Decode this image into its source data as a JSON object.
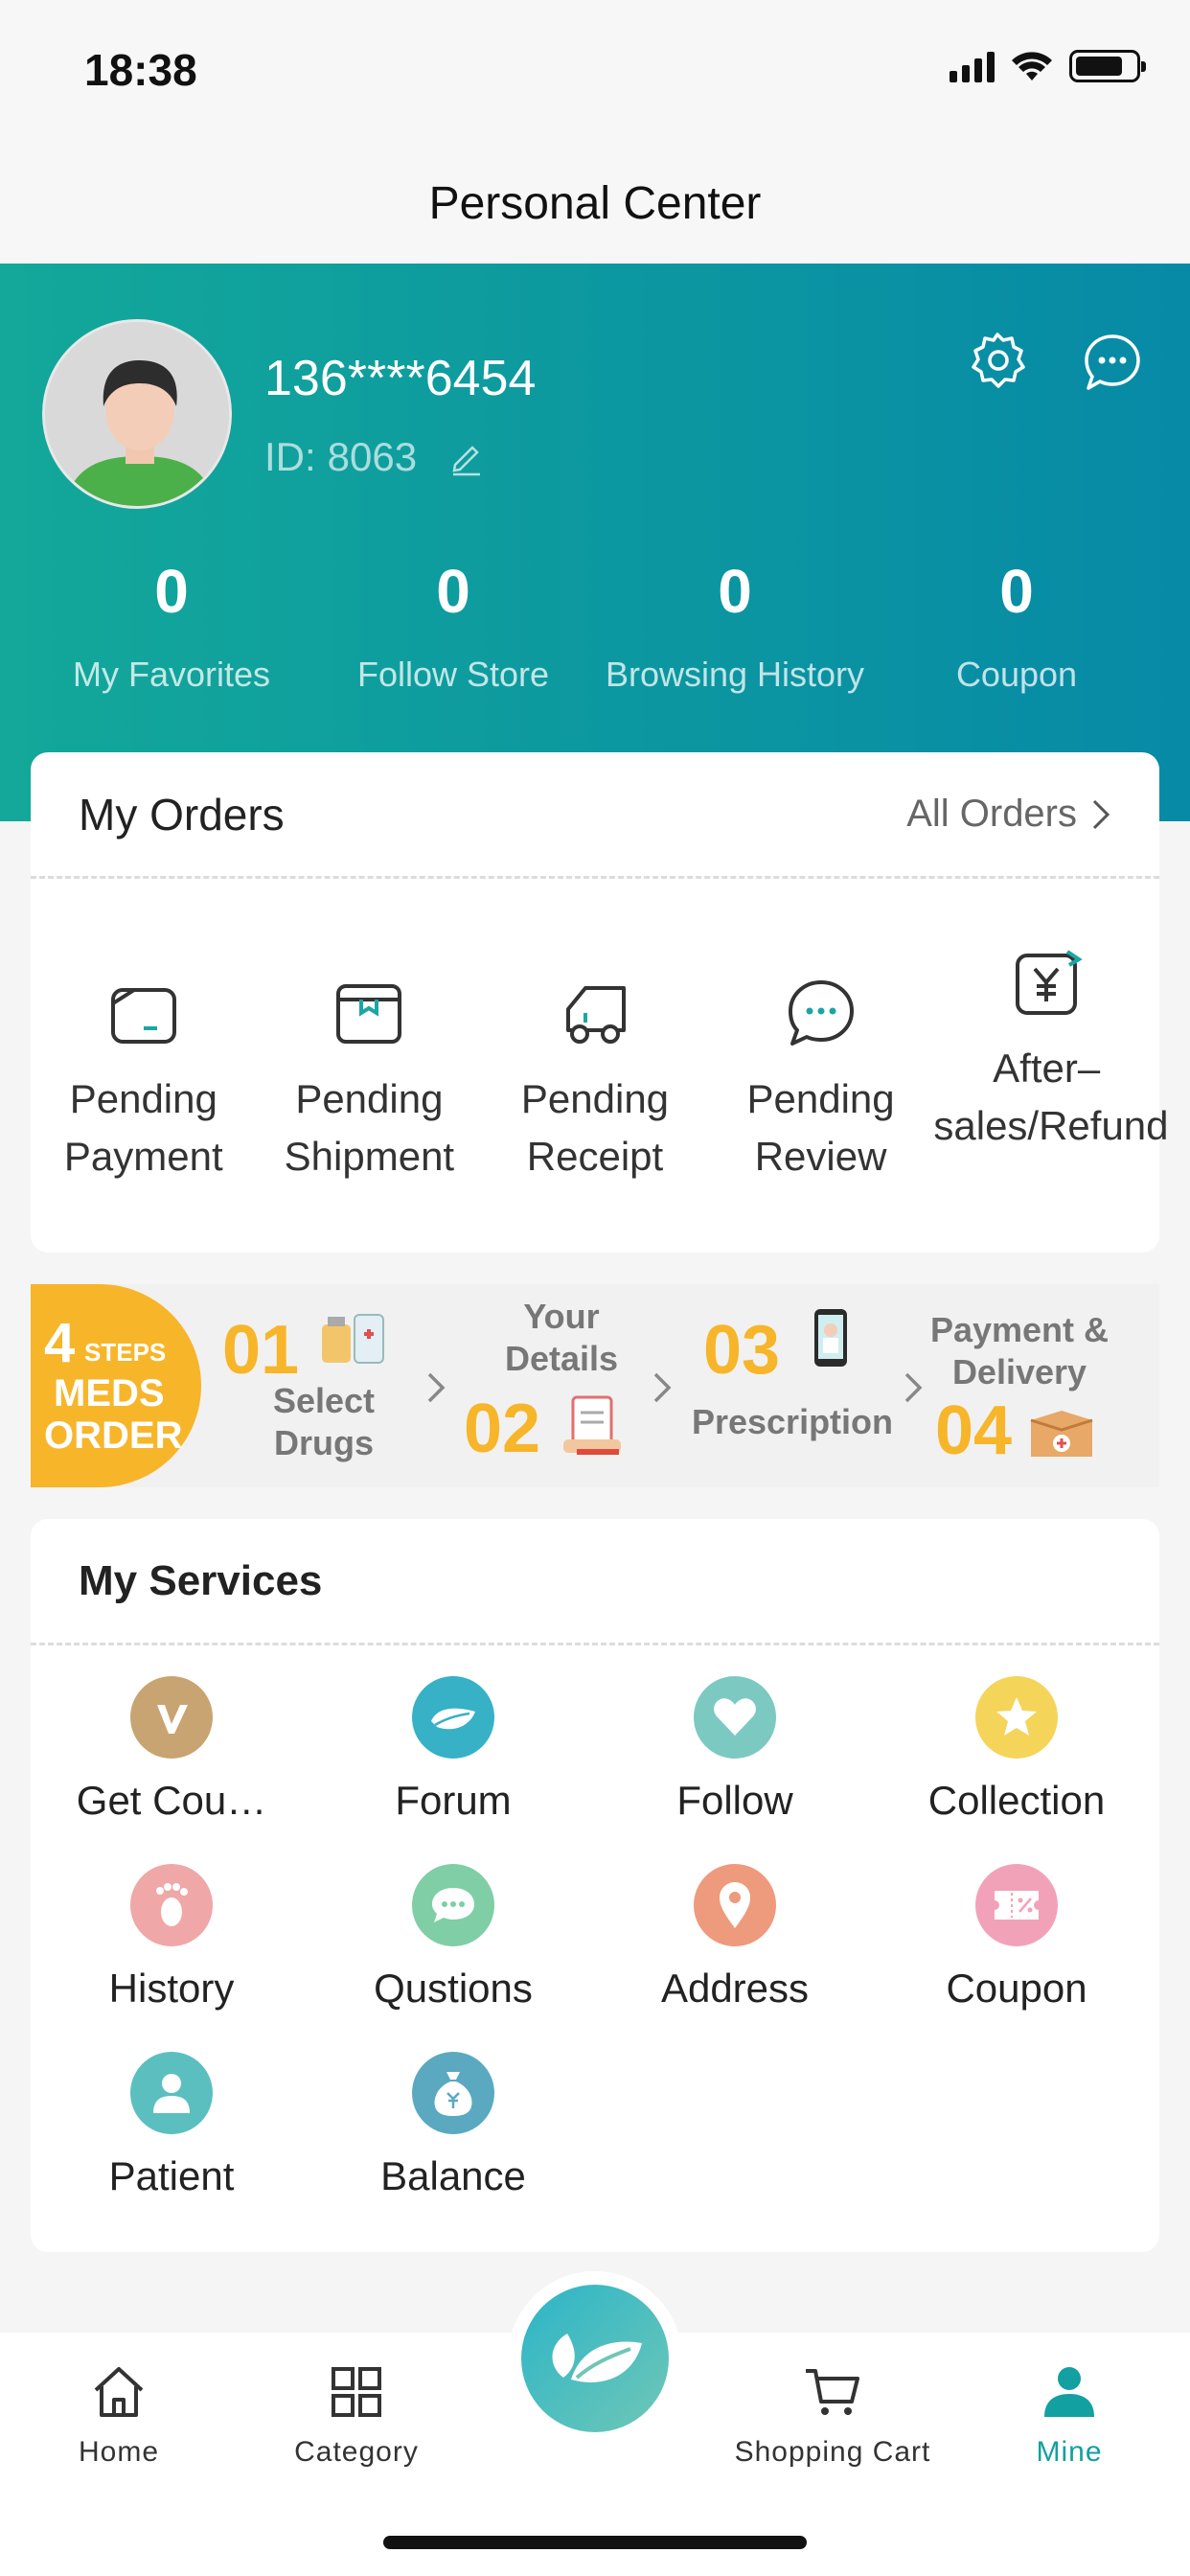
{
  "status_bar": {
    "time": "18:38"
  },
  "nav": {
    "title": "Personal Center"
  },
  "profile": {
    "username": "136****6454",
    "id_label": "ID:",
    "id_value": "8063"
  },
  "stats": [
    {
      "value": "0",
      "label": "My Favorites"
    },
    {
      "value": "0",
      "label": "Follow Store"
    },
    {
      "value": "0",
      "label": "Browsing History"
    },
    {
      "value": "0",
      "label": "Coupon"
    }
  ],
  "orders": {
    "title": "My Orders",
    "all_label": "All Orders",
    "items": [
      {
        "label": "Pending Payment",
        "icon": "wallet-icon"
      },
      {
        "label": "Pending Shipment",
        "icon": "package-icon"
      },
      {
        "label": "Pending Receipt",
        "icon": "truck-icon"
      },
      {
        "label": "Pending Review",
        "icon": "chat-bubble-icon"
      },
      {
        "label": "After–sales/Refund",
        "icon": "refund-yen-icon"
      }
    ]
  },
  "steps_banner": {
    "badge_num": "4",
    "badge_steps": "STEPS",
    "badge_line1": "MEDS",
    "badge_line2": "ORDER",
    "steps": [
      {
        "num": "01",
        "text": "Select Drugs"
      },
      {
        "num": "02",
        "text": "Your Details"
      },
      {
        "num": "03",
        "text": "Prescription"
      },
      {
        "num": "04",
        "text": "Payment & Delivery"
      }
    ]
  },
  "services": {
    "title": "My Services",
    "items": [
      {
        "label": "Get Cou…",
        "icon": "v-coupon-icon",
        "color": "#c8a472"
      },
      {
        "label": "Forum",
        "icon": "leaf-icon",
        "color": "#36b1c6"
      },
      {
        "label": "Follow",
        "icon": "heart-icon",
        "color": "#7cc9c2"
      },
      {
        "label": "Collection",
        "icon": "star-icon",
        "color": "#f5d45a"
      },
      {
        "label": "History",
        "icon": "footprint-icon",
        "color": "#f0a7a7"
      },
      {
        "label": "Qustions",
        "icon": "chat-dots-icon",
        "color": "#7fcea5"
      },
      {
        "label": "Address",
        "icon": "location-pin-icon",
        "color": "#ee9a7c"
      },
      {
        "label": "Coupon",
        "icon": "ticket-icon",
        "color": "#f2a2b8"
      },
      {
        "label": "Patient",
        "icon": "person-icon",
        "color": "#5bbfc0"
      },
      {
        "label": "Balance",
        "icon": "money-bag-icon",
        "color": "#5aa9c0"
      }
    ]
  },
  "tabbar": {
    "tabs": [
      {
        "label": "Home",
        "icon": "home-icon"
      },
      {
        "label": "Category",
        "icon": "grid-icon"
      },
      {
        "label": "Shopping Cart",
        "icon": "cart-icon"
      },
      {
        "label": "Mine",
        "icon": "user-icon"
      }
    ],
    "active": "Mine",
    "accent": "#13a0a0"
  }
}
